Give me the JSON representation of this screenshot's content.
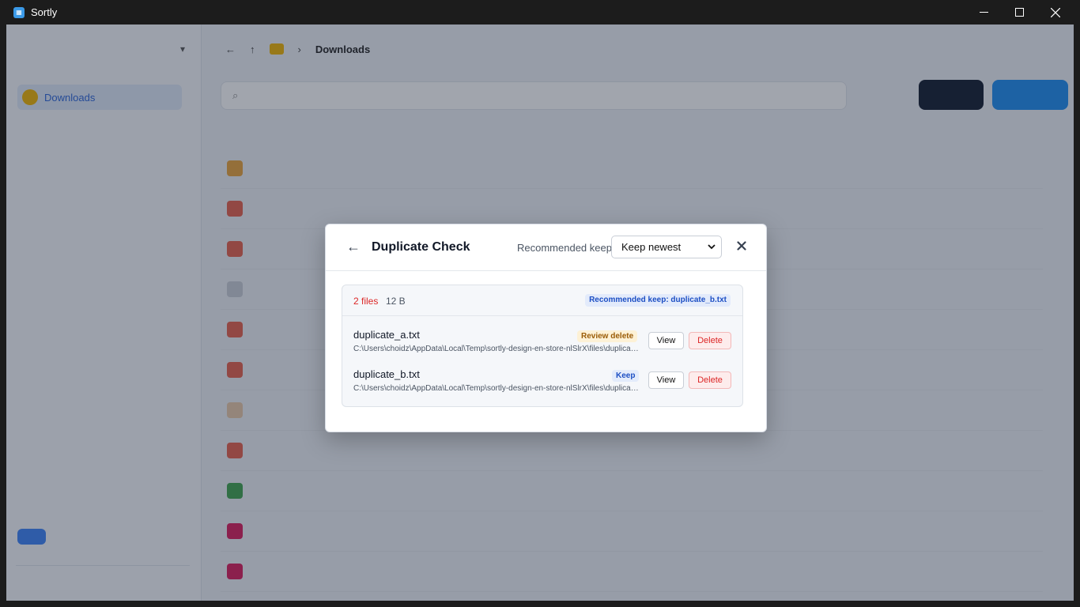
{
  "window": {
    "title": "Sortly"
  },
  "sidebar": {
    "item_label": "Downloads"
  },
  "breadcrumb": {
    "current": "Downloads"
  },
  "modal": {
    "title": "Duplicate Check",
    "recommended_label": "Recommended keep:",
    "select_value": "Keep newest",
    "group": {
      "count": "2 files",
      "size": "12 B",
      "badge": "Recommended keep: duplicate_b.txt",
      "files": [
        {
          "name": "duplicate_a.txt",
          "path": "C:\\Users\\choidz\\AppData\\Local\\Temp\\sortly-design-en-store-nlSlrX\\files\\duplicate_a.txt",
          "tag": "Review delete",
          "view": "View",
          "delete": "Delete"
        },
        {
          "name": "duplicate_b.txt",
          "path": "C:\\Users\\choidz\\AppData\\Local\\Temp\\sortly-design-en-store-nlSlrX\\files\\duplicate_b.txt",
          "tag": "Keep",
          "view": "View",
          "delete": "Delete"
        }
      ]
    }
  },
  "colors": {
    "accent": "#2a64d9",
    "danger": "#dc2626",
    "warning_tag": "#9a5b06",
    "titlebar": "#1c1c1c"
  }
}
